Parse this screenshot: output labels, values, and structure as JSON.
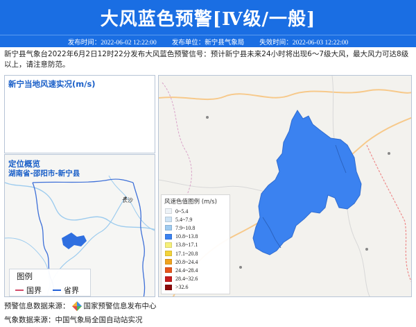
{
  "header": {
    "title": "大风蓝色预警[Ⅳ级/一般]",
    "publish_time": "发布时间：2022-06-02 12:22:00",
    "publisher": "发布单位：新宁县气象局",
    "expire_time": "失效时间：2022-06-03 12:22:00"
  },
  "description": "新宁县气象台2022年6月2日12时22分发布大风蓝色预警信号：预计新宁县未来24小时将出现6～7级大风，最大风力可达8级以上，请注意防范。",
  "wind_panel": {
    "title": "新宁当地风速实况(m/s)"
  },
  "location_panel": {
    "title": "定位概览",
    "region": "湖南省-邵阳市-新宁县",
    "city_label": "长沙",
    "legend": {
      "title": "图例",
      "items": [
        {
          "label": "国界",
          "color": "#d24b6a"
        },
        {
          "label": "省界",
          "color": "#2260d8"
        }
      ]
    }
  },
  "wind_legend": {
    "title": "风速色值图例 (m/s)",
    "items": [
      {
        "label": "0~5.4",
        "color": "#eef3f7"
      },
      {
        "label": "5.4~7.9",
        "color": "#cfe4f5"
      },
      {
        "label": "7.9~10.8",
        "color": "#9fcbf0"
      },
      {
        "label": "10.8~13.8",
        "color": "#3b82f0"
      },
      {
        "label": "13.8~17.1",
        "color": "#f6f07a"
      },
      {
        "label": "17.1~20.8",
        "color": "#f3d33a"
      },
      {
        "label": "20.8~24.4",
        "color": "#f0a31e"
      },
      {
        "label": "24.4~28.4",
        "color": "#e8561c"
      },
      {
        "label": "28.4~32.6",
        "color": "#c81c1c"
      },
      {
        "label": ">32.6",
        "color": "#8c0a0a"
      }
    ]
  },
  "warning_region_color": "#3b82f0",
  "sources": {
    "warning_prefix": "预警信息数据来源：",
    "warning_source": "国家预警信息发布中心",
    "weather_prefix": "气象数据来源：",
    "weather_source": "中国气象局全国自动站实况"
  }
}
